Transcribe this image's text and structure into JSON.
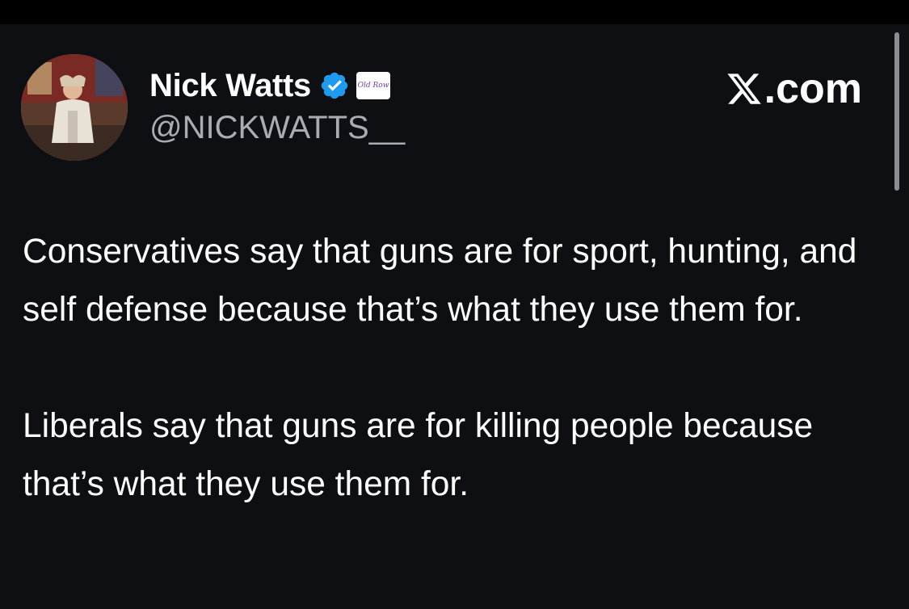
{
  "tweet": {
    "author": {
      "display_name": "Nick Watts",
      "handle": "@NICKWATTS__",
      "verified": true,
      "affiliate_badge_text": "Old Row",
      "avatar_icon": "user-avatar-photo"
    },
    "source_label": ".com",
    "source_logo_icon": "x-logo-icon",
    "paragraphs": [
      "Conservatives say that guns are for sport, hunting, and self defense because that’s what they use them for.",
      "Liberals say that guns are for killing people because that’s what they use them for."
    ]
  },
  "colors": {
    "background": "#0e0f12",
    "text": "#ffffff",
    "handle": "#a8adb3",
    "verified_blue": "#1d9bf0",
    "scrollbar": "#8a8d92"
  }
}
